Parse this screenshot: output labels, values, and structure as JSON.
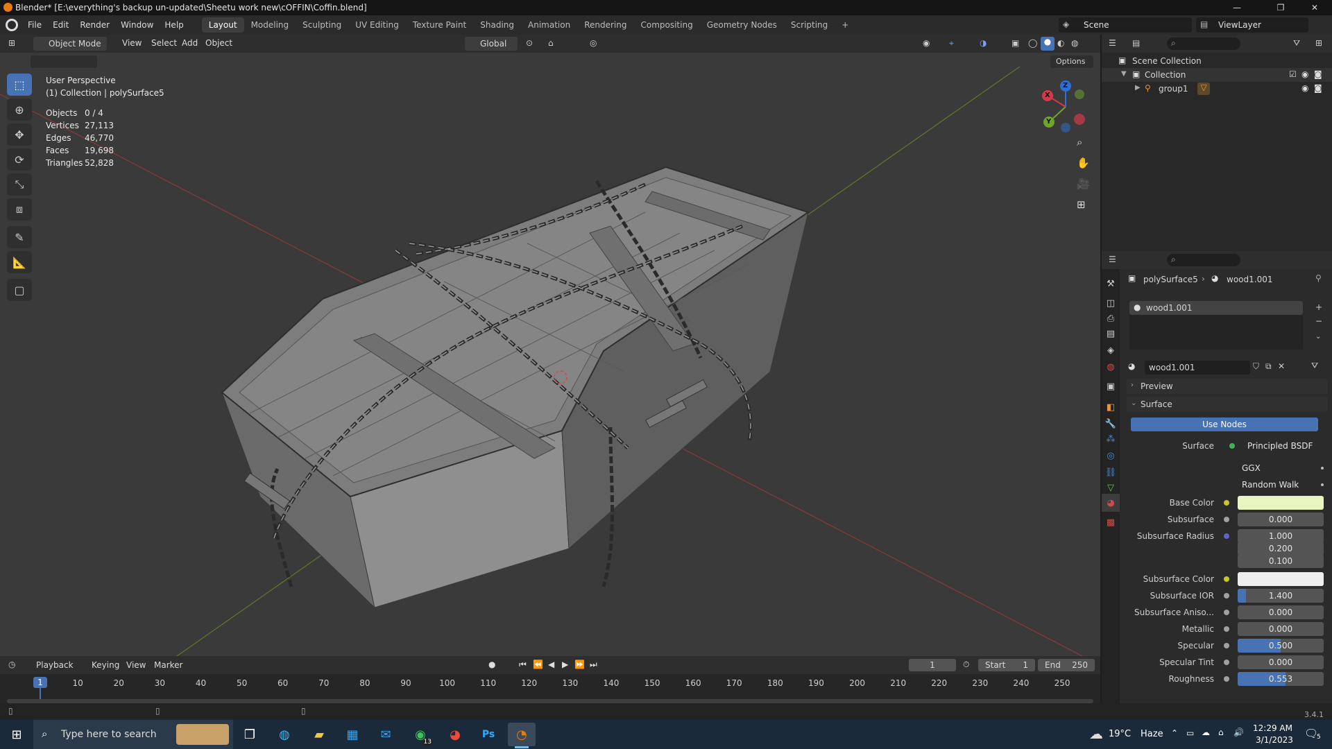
{
  "window": {
    "title": "Blender* [E:\\everything's backup un-updated\\Sheetu work new\\cOFFIN\\Coffin.blend]",
    "minimize": "—",
    "maximize": "❐",
    "close": "✕"
  },
  "menu": {
    "items": [
      "File",
      "Edit",
      "Render",
      "Window",
      "Help"
    ],
    "workspaces": [
      "Layout",
      "Modeling",
      "Sculpting",
      "UV Editing",
      "Texture Paint",
      "Shading",
      "Animation",
      "Rendering",
      "Compositing",
      "Geometry Nodes",
      "Scripting"
    ],
    "add_workspace": "+",
    "scene": "Scene",
    "view_layer": "ViewLayer"
  },
  "viewport_header": {
    "mode": "Object Mode",
    "menus": [
      "View",
      "Select",
      "Add",
      "Object"
    ],
    "orientation": "Global",
    "options": "Options"
  },
  "overlay": {
    "perspective": "User Perspective",
    "collection": "(1) Collection | polySurface5",
    "stats": [
      {
        "label": "Objects",
        "value": "0 / 4"
      },
      {
        "label": "Vertices",
        "value": "27,113"
      },
      {
        "label": "Edges",
        "value": "46,770"
      },
      {
        "label": "Faces",
        "value": "19,698"
      },
      {
        "label": "Triangles",
        "value": "52,828"
      }
    ]
  },
  "gizmo": {
    "x": "X",
    "y": "Y",
    "z": "Z"
  },
  "outliner": {
    "scene_collection": "Scene Collection",
    "collection": "Collection",
    "group": "group1"
  },
  "properties": {
    "breadcrumb_object": "polySurface5",
    "breadcrumb_material": "wood1.001",
    "slot": "wood1.001",
    "material_name": "wood1.001",
    "preview": "Preview",
    "surface_panel": "Surface",
    "use_nodes": "Use Nodes",
    "surface_label": "Surface",
    "surface_value": "Principled BSDF",
    "distribution": "GGX",
    "subsurface_method": "Random Walk",
    "rows": [
      {
        "label": "Base Color",
        "type": "color",
        "color": "#e9f5c0"
      },
      {
        "label": "Subsurface",
        "value": "0.000",
        "fill": 0
      },
      {
        "label": "Subsurface Radius",
        "value": "1.000",
        "fill": 0
      },
      {
        "label": "",
        "value": "0.200",
        "fill": 0
      },
      {
        "label": "",
        "value": "0.100",
        "fill": 0
      },
      {
        "label": "Subsurface Color",
        "type": "color",
        "color": "#eeeeee"
      },
      {
        "label": "Subsurface IOR",
        "value": "1.400",
        "fill": 0.1
      },
      {
        "label": "Subsurface Aniso...",
        "value": "0.000",
        "fill": 0
      },
      {
        "label": "Metallic",
        "value": "0.000",
        "fill": 0
      },
      {
        "label": "Specular",
        "value": "0.500",
        "fill": 0.5
      },
      {
        "label": "Specular Tint",
        "value": "0.000",
        "fill": 0
      },
      {
        "label": "Roughness",
        "value": "0.553",
        "fill": 0.553
      }
    ]
  },
  "timeline": {
    "menus": [
      "Playback",
      "Keying",
      "View",
      "Marker"
    ],
    "current_frame": "1",
    "start_label": "Start",
    "start": "1",
    "end_label": "End",
    "end": "250",
    "ticks": [
      "1",
      "10",
      "20",
      "30",
      "40",
      "50",
      "60",
      "70",
      "80",
      "90",
      "100",
      "110",
      "120",
      "130",
      "140",
      "150",
      "160",
      "170",
      "180",
      "190",
      "200",
      "210",
      "220",
      "230",
      "240",
      "250"
    ]
  },
  "status": {
    "version": "3.4.1"
  },
  "taskbar": {
    "search_placeholder": "Type here to search",
    "weather_temp": "19°C",
    "weather_desc": "Haze",
    "time": "12:29 AM",
    "date": "3/1/2023",
    "whatsapp_badge": "13",
    "notif_count": "5",
    "ps_label": "Ps"
  },
  "colors": {
    "accent": "#4772b3",
    "active_tab": "#3d3d3d",
    "viewport_bg": "#3a3a3a"
  }
}
